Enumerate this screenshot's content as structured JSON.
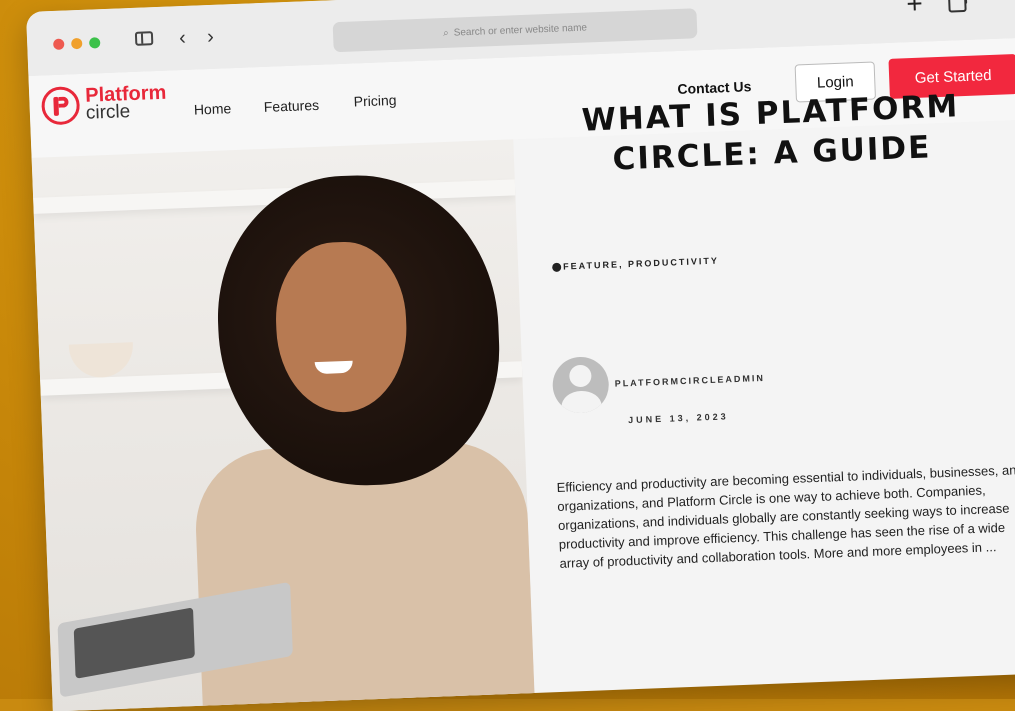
{
  "browser": {
    "address_placeholder": "Search or enter website name"
  },
  "site": {
    "logo": {
      "word1": "Platform",
      "word2": "circle"
    },
    "nav": [
      {
        "label": "Home"
      },
      {
        "label": "Features"
      },
      {
        "label": "Pricing"
      }
    ],
    "contact_label": "Contact Us",
    "login_label": "Login",
    "cta_label": "Get Started"
  },
  "article": {
    "title": "WHAT IS PLATFORM CIRCLE: A GUIDE",
    "categories": "FEATURE, PRODUCTIVITY",
    "author": "PLATFORMCIRCLEADMIN",
    "date": "JUNE 13, 2023",
    "excerpt": "Efficiency and productivity are becoming essential to individuals, businesses, and organizations, and Platform Circle is one way to achieve both. Companies, organizations, and individuals globally are constantly seeking ways to increase productivity and improve efficiency. This challenge has seen the rise of a wide array of productivity and collaboration tools. More and more employees in ..."
  },
  "colors": {
    "background": "#c98a10",
    "brand_red": "#e8283a",
    "cta_red": "#f2283e"
  },
  "icons": [
    "sidebar-toggle-icon",
    "back-icon",
    "forward-icon",
    "search-icon",
    "new-tab-icon",
    "tabs-overview-icon",
    "tag-icon",
    "avatar-placeholder-icon"
  ]
}
